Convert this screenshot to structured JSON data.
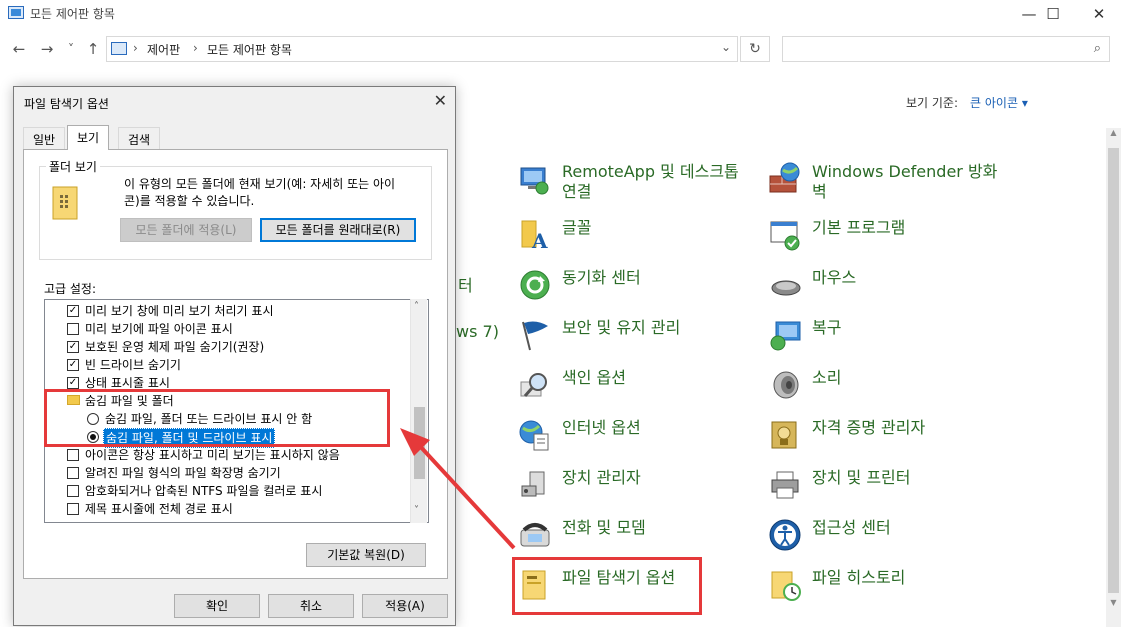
{
  "window": {
    "title": "모든 제어판 항목",
    "minimize": "—",
    "maximize": "☐",
    "close": "✕"
  },
  "nav": {
    "back": "←",
    "forward": "→",
    "recent": "˅",
    "up": "↑",
    "breadcrumb": [
      "제어판",
      "모든 제어판 항목"
    ],
    "separator": "›",
    "dropdown": "⌄",
    "refresh": "↻",
    "search_placeholder": "",
    "search_icon": "⌕"
  },
  "view_by": {
    "label": "보기 기준:",
    "value": "큰 아이콘 ▾"
  },
  "partial_items": [
    "터",
    "ws 7)"
  ],
  "items": [
    {
      "label": "RemoteApp 및 데스크톱 연결",
      "line1": "RemoteApp 및 데스크톱",
      "line2": "연결",
      "icon": "remoteapp-icon"
    },
    {
      "label": "Windows Defender 방화벽",
      "line1": "Windows Defender 방화",
      "line2": "벽",
      "icon": "firewall-icon"
    },
    {
      "label": "글꼴",
      "icon": "fonts-icon"
    },
    {
      "label": "기본 프로그램",
      "icon": "default-programs-icon"
    },
    {
      "label": "동기화 센터",
      "icon": "sync-center-icon"
    },
    {
      "label": "마우스",
      "icon": "mouse-icon"
    },
    {
      "label": "보안 및 유지 관리",
      "icon": "security-flag-icon"
    },
    {
      "label": "복구",
      "icon": "recovery-icon"
    },
    {
      "label": "색인 옵션",
      "icon": "indexing-icon"
    },
    {
      "label": "소리",
      "icon": "sound-icon"
    },
    {
      "label": "인터넷 옵션",
      "icon": "internet-options-icon"
    },
    {
      "label": "자격 증명 관리자",
      "icon": "credential-manager-icon"
    },
    {
      "label": "장치 관리자",
      "icon": "device-manager-icon"
    },
    {
      "label": "장치 및 프린터",
      "icon": "printer-icon"
    },
    {
      "label": "전화 및 모뎀",
      "icon": "phone-modem-icon"
    },
    {
      "label": "접근성 센터",
      "icon": "ease-of-access-icon"
    },
    {
      "label": "파일 탐색기 옵션",
      "icon": "folder-options-icon"
    },
    {
      "label": "파일 히스토리",
      "icon": "file-history-icon"
    }
  ],
  "dialog": {
    "title": "파일 탐색기 옵션",
    "close": "✕",
    "tabs": [
      "일반",
      "보기",
      "검색"
    ],
    "active_tab": "보기",
    "folder_view": {
      "group_label": "폴더 보기",
      "description": "이 유형의 모든 폴더에 현재 보기(예: 자세히 또는 아이콘)를 적용할 수 있습니다.",
      "desc_line1": "이 유형의 모든 폴더에 현재 보기(예: 자세히 또는 아이",
      "desc_line2": "콘)를 적용할 수 있습니다.",
      "apply_btn": "모든 폴더에 적용(L)",
      "reset_btn": "모든 폴더를 원래대로(R)"
    },
    "advanced_label": "고급 설정:",
    "advanced_rows": [
      {
        "type": "checkbox",
        "checked": true,
        "text": "미리 보기 창에 미리 보기 처리기 표시"
      },
      {
        "type": "checkbox",
        "checked": false,
        "text": "미리 보기에 파일 아이콘 표시"
      },
      {
        "type": "checkbox",
        "checked": true,
        "text": "보호된 운영 체제 파일 숨기기(권장)"
      },
      {
        "type": "checkbox",
        "checked": true,
        "text": "빈 드라이브 숨기기"
      },
      {
        "type": "checkbox",
        "checked": true,
        "text": "상태 표시줄 표시"
      },
      {
        "type": "folder",
        "text": "숨김 파일 및 폴더"
      },
      {
        "type": "radio",
        "checked": false,
        "text": "숨김 파일, 폴더 또는 드라이브 표시 안 함"
      },
      {
        "type": "radio",
        "checked": true,
        "text": "숨김 파일, 폴더 및 드라이브 표시"
      },
      {
        "type": "checkbox",
        "checked": false,
        "text": "아이콘은 항상 표시하고 미리 보기는 표시하지 않음"
      },
      {
        "type": "checkbox",
        "checked": false,
        "text": "알려진 파일 형식의 파일 확장명 숨기기"
      },
      {
        "type": "checkbox",
        "checked": false,
        "text": "암호화되거나 압축된 NTFS 파일을 컬러로 표시"
      },
      {
        "type": "checkbox",
        "checked": false,
        "text": "제목 표시줄에 전체 경로 표시"
      }
    ],
    "restore_defaults": "기본값 복원(D)",
    "ok": "확인",
    "cancel": "취소",
    "apply": "적용(A)",
    "check_mark": "✓",
    "scroll_up": "˄",
    "scroll_down": "˅"
  },
  "colors": {
    "link_green": "#2a6a26",
    "highlight_red": "#e5393a",
    "selection_blue": "#0078d7"
  }
}
